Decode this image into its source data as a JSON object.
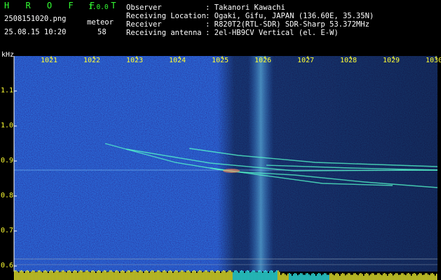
{
  "header": {
    "app_title": "H R O F F T",
    "version": "1.0.0",
    "filename": "2508151020.png",
    "detection_label": "meteor",
    "datetime": "25.08.15 10:20",
    "detection_count": "58",
    "info": [
      {
        "label": "Observer",
        "value": ": Takanori Kawachi"
      },
      {
        "label": "Receiving Location",
        "value": ": Ogaki, Gifu, JAPAN (136.60E, 35.35N)"
      },
      {
        "label": "Receiver",
        "value": ": R820T2(RTL-SDR) SDR-Sharp 53.372MHz"
      },
      {
        "label": "Receiving antenna",
        "value": ": 2el-HB9CV Vertical (el. E-W)"
      }
    ]
  },
  "colors": {
    "background": "#000000",
    "spectrogram_base": "#0a1fa0",
    "trail": "#55ffcc",
    "header_text": "#33ff33",
    "label_text": "#ffffff",
    "tick_text": "#ffff33",
    "level_bar": "#ffff33",
    "level_bar_alt": "#33ffff"
  },
  "axis": {
    "unit_label": "kHz",
    "y_ticks": [
      "1.1",
      "1.0",
      "0.9",
      "0.8",
      "0.7",
      "0.6"
    ],
    "x_ticks": [
      "1021",
      "1022",
      "1023",
      "1024",
      "1025",
      "1026",
      "1027",
      "1028",
      "1029",
      "1030"
    ]
  }
}
